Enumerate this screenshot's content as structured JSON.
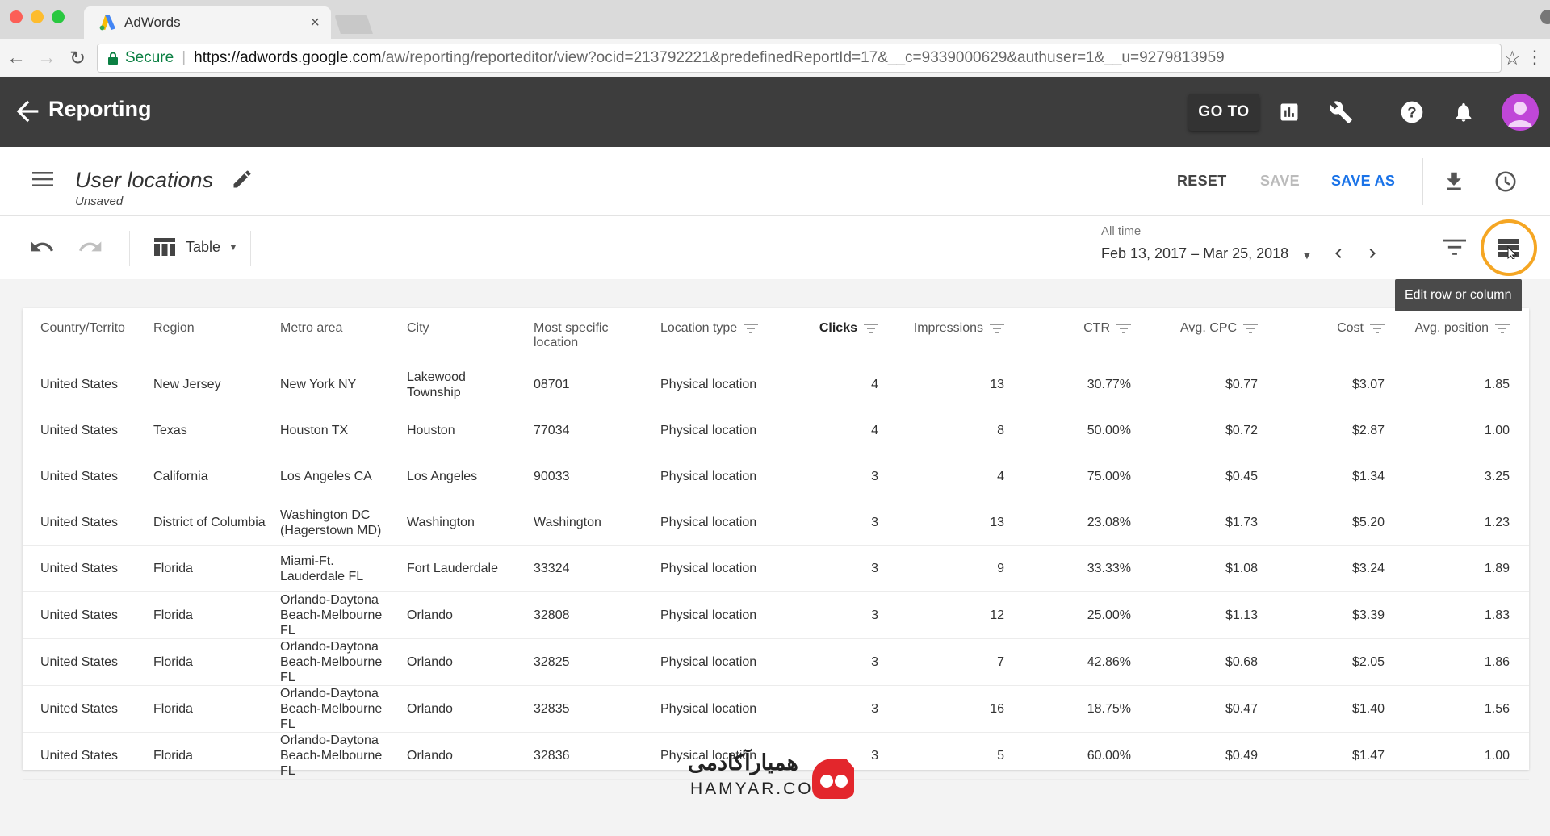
{
  "browser": {
    "tab_title": "AdWords",
    "tab_close": "×",
    "secure_label": "Secure",
    "url_host": "https://adwords.google.com",
    "url_path": "/aw/reporting/reporteditor/view?ocid=213792221&predefinedReportId=17&__c=9339000629&authuser=1&__u=9279813959"
  },
  "app": {
    "title": "Reporting",
    "goto_label": "GO TO"
  },
  "report": {
    "name": "User locations",
    "status": "Unsaved",
    "reset_label": "RESET",
    "save_label": "SAVE",
    "save_as_label": "SAVE AS"
  },
  "toolbar": {
    "view_label": "Table",
    "date_label": "All time",
    "date_range": "Feb 13, 2017 – Mar 25, 2018",
    "tooltip": "Edit row or column"
  },
  "colors": {
    "accent": "#1a73e8",
    "appbar": "#3d3d3d",
    "highlight_ring": "#f5a623",
    "avatar": "#c047d8"
  },
  "table": {
    "columns": [
      "Country/Territo",
      "Region",
      "Metro area",
      "City",
      "Most specific location",
      "Location type",
      "Clicks",
      "Impressions",
      "CTR",
      "Avg. CPC",
      "Cost",
      "Avg. position"
    ],
    "rows": [
      [
        "United States",
        "New Jersey",
        "New York NY",
        "Lakewood Township",
        "08701",
        "Physical location",
        "4",
        "13",
        "30.77%",
        "$0.77",
        "$3.07",
        "1.85"
      ],
      [
        "United States",
        "Texas",
        "Houston TX",
        "Houston",
        "77034",
        "Physical location",
        "4",
        "8",
        "50.00%",
        "$0.72",
        "$2.87",
        "1.00"
      ],
      [
        "United States",
        "California",
        "Los Angeles CA",
        "Los Angeles",
        "90033",
        "Physical location",
        "3",
        "4",
        "75.00%",
        "$0.45",
        "$1.34",
        "3.25"
      ],
      [
        "United States",
        "District of Columbia",
        "Washington DC (Hagerstown MD)",
        "Washington",
        "Washington",
        "Physical location",
        "3",
        "13",
        "23.08%",
        "$1.73",
        "$5.20",
        "1.23"
      ],
      [
        "United States",
        "Florida",
        "Miami-Ft. Lauderdale FL",
        "Fort Lauderdale",
        "33324",
        "Physical location",
        "3",
        "9",
        "33.33%",
        "$1.08",
        "$3.24",
        "1.89"
      ],
      [
        "United States",
        "Florida",
        "Orlando-Daytona Beach-Melbourne FL",
        "Orlando",
        "32808",
        "Physical location",
        "3",
        "12",
        "25.00%",
        "$1.13",
        "$3.39",
        "1.83"
      ],
      [
        "United States",
        "Florida",
        "Orlando-Daytona Beach-Melbourne FL",
        "Orlando",
        "32825",
        "Physical location",
        "3",
        "7",
        "42.86%",
        "$0.68",
        "$2.05",
        "1.86"
      ],
      [
        "United States",
        "Florida",
        "Orlando-Daytona Beach-Melbourne FL",
        "Orlando",
        "32835",
        "Physical location",
        "3",
        "16",
        "18.75%",
        "$0.47",
        "$1.40",
        "1.56"
      ],
      [
        "United States",
        "Florida",
        "Orlando-Daytona Beach-Melbourne FL",
        "Orlando",
        "32836",
        "Physical location",
        "3",
        "5",
        "60.00%",
        "$0.49",
        "$1.47",
        "1.00"
      ]
    ]
  },
  "watermark": {
    "persian": "همیارآکادمی",
    "latin": "HAMYAR.CO"
  }
}
